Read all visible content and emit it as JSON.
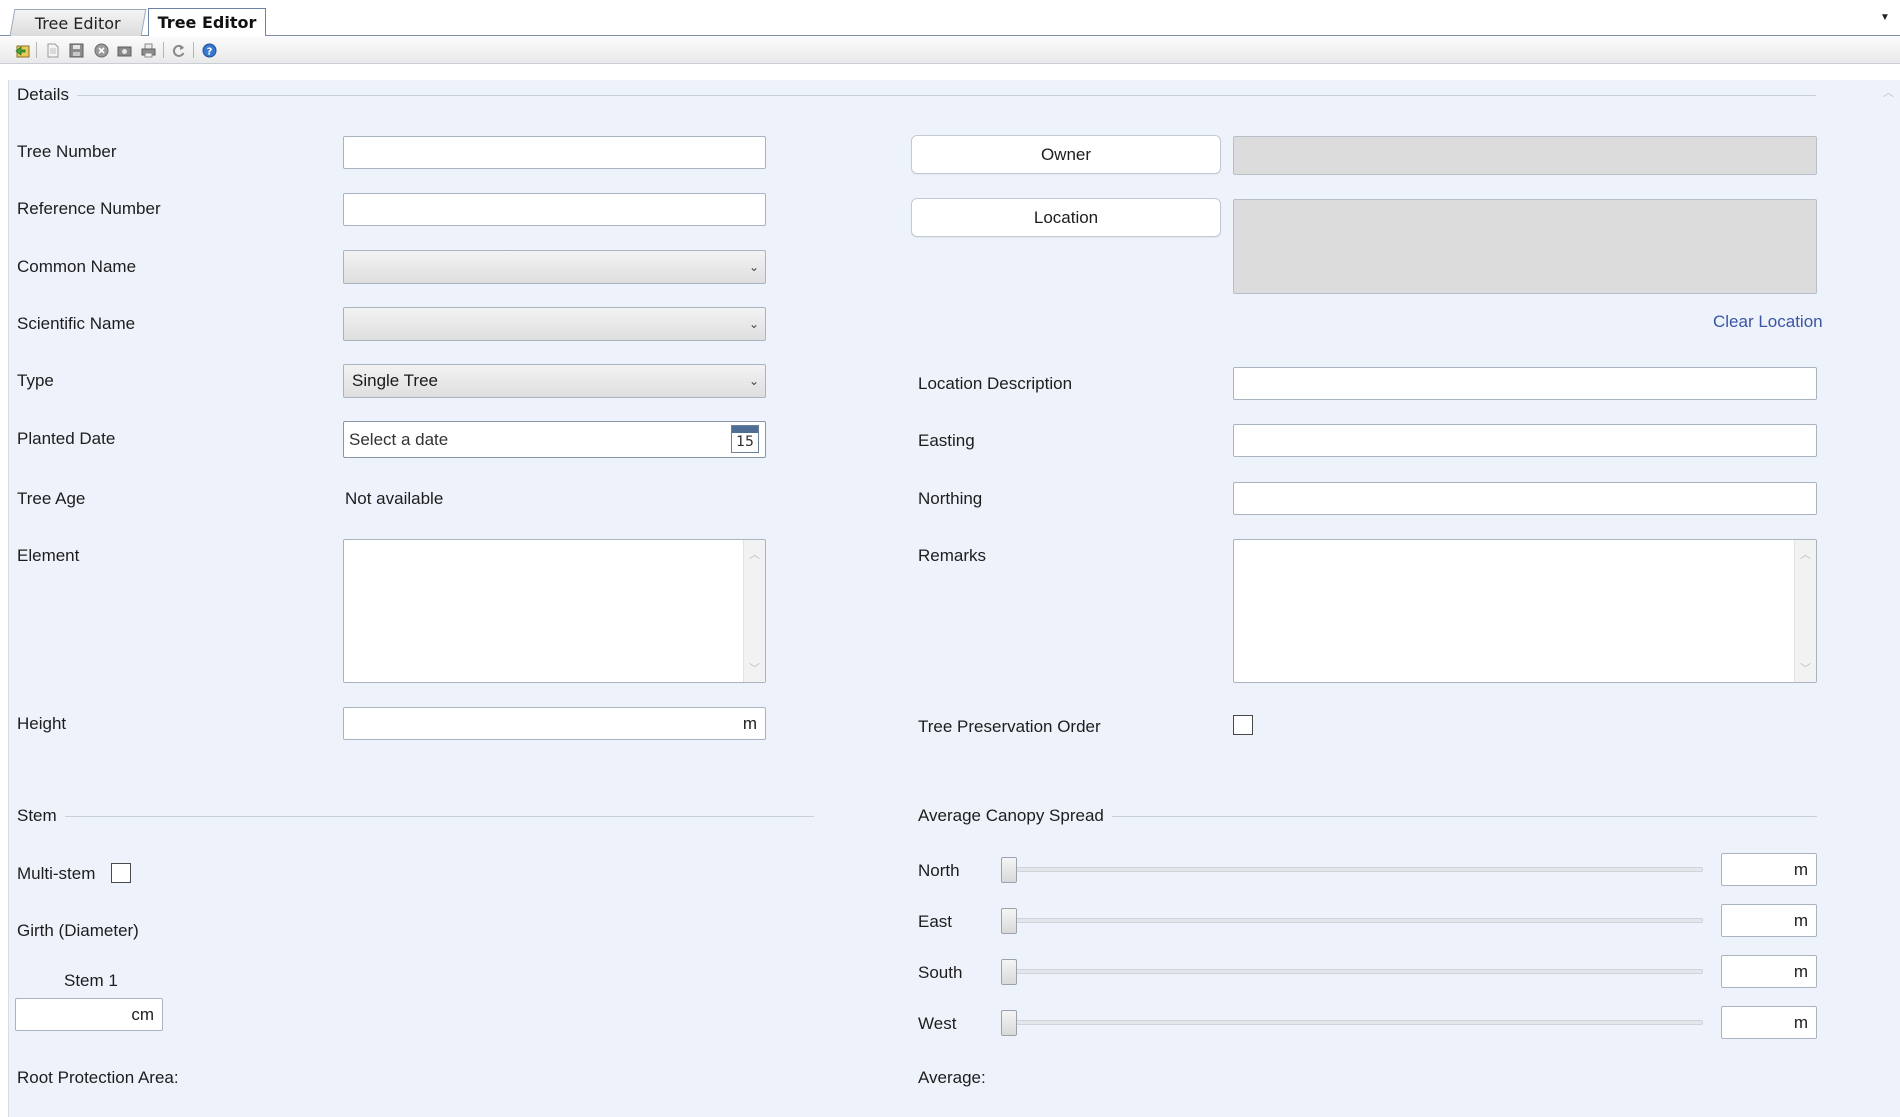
{
  "tabs": [
    {
      "label": "Tree Editor",
      "active": false
    },
    {
      "label": "Tree Editor",
      "active": true
    }
  ],
  "toolbar": {
    "buttons": [
      "back-icon",
      "new-document-icon",
      "save-icon",
      "close-icon",
      "camera-icon",
      "print-icon",
      "refresh-icon",
      "help-icon"
    ]
  },
  "details": {
    "section_title": "Details",
    "tree_number": {
      "label": "Tree Number",
      "value": ""
    },
    "reference_number": {
      "label": "Reference Number",
      "value": ""
    },
    "common_name": {
      "label": "Common Name",
      "value": ""
    },
    "scientific_name": {
      "label": "Scientific Name",
      "value": ""
    },
    "type": {
      "label": "Type",
      "value": "Single Tree"
    },
    "planted_date": {
      "label": "Planted Date",
      "placeholder": "Select a date",
      "calendar_day": "15"
    },
    "tree_age": {
      "label": "Tree Age",
      "value": "Not available"
    },
    "element": {
      "label": "Element",
      "value": ""
    },
    "height": {
      "label": "Height",
      "value": "",
      "unit": "m"
    },
    "owner": {
      "button_label": "Owner",
      "value": ""
    },
    "location": {
      "button_label": "Location",
      "value": "",
      "clear_link": "Clear Location"
    },
    "location_description": {
      "label": "Location Description",
      "value": ""
    },
    "easting": {
      "label": "Easting",
      "value": ""
    },
    "northing": {
      "label": "Northing",
      "value": ""
    },
    "remarks": {
      "label": "Remarks",
      "value": ""
    },
    "tpo": {
      "label": "Tree Preservation Order",
      "checked": false
    }
  },
  "stem": {
    "section_title": "Stem",
    "multi_stem": {
      "label": "Multi-stem",
      "checked": false
    },
    "girth_label": "Girth (Diameter)",
    "stem1": {
      "label": "Stem 1",
      "value": "",
      "unit": "cm"
    },
    "root_protection_area": {
      "label": "Root Protection Area:"
    }
  },
  "canopy": {
    "section_title": "Average Canopy Spread",
    "north": {
      "label": "North",
      "value": "",
      "unit": "m",
      "level": 0
    },
    "east": {
      "label": "East",
      "value": "",
      "unit": "m",
      "level": 0
    },
    "south": {
      "label": "South",
      "value": "",
      "unit": "m",
      "level": 0
    },
    "west": {
      "label": "West",
      "value": "",
      "unit": "m",
      "level": 0
    },
    "average": {
      "label": "Average:"
    }
  }
}
